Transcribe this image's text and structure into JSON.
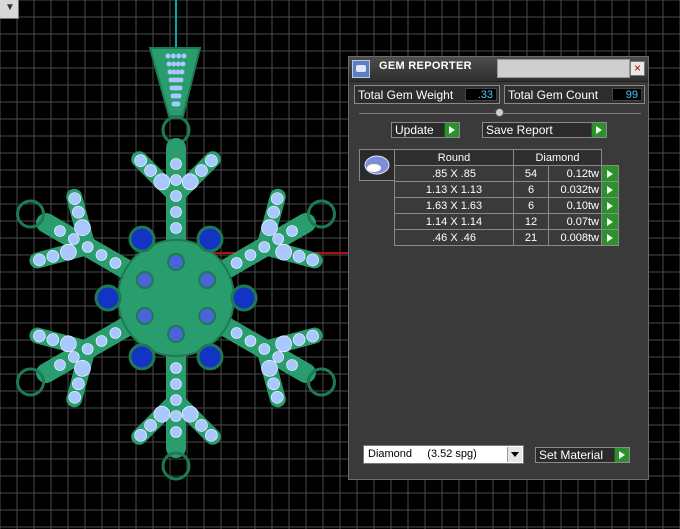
{
  "panel": {
    "title": "GEM REPORTER",
    "close_glyph": "×",
    "total_weight_label": "Total Gem Weight",
    "total_weight_value": ".33",
    "total_count_label": "Total Gem Count",
    "total_count_value": "99",
    "update_label": "Update",
    "save_label": "Save Report",
    "table": {
      "headers": [
        "Round",
        "Diamond"
      ],
      "rows": [
        {
          "size": ".85 X .85",
          "count": "54",
          "weight": "0.12tw"
        },
        {
          "size": "1.13 X 1.13",
          "count": "6",
          "weight": "0.032tw"
        },
        {
          "size": "1.63 X 1.63",
          "count": "6",
          "weight": "0.10tw"
        },
        {
          "size": "1.14 X 1.14",
          "count": "12",
          "weight": "0.07tw"
        },
        {
          "size": ".46 X .46",
          "count": "21",
          "weight": "0.008tw"
        }
      ]
    },
    "material_select": "Diamond     (3.52 spg)",
    "set_material_label": "Set Material"
  },
  "viewport": {
    "corner_glyph": "▼"
  },
  "colors": {
    "metal": "#2a9d6e",
    "metal_dark": "#1d7a52",
    "small_gem": "#a9c8ff",
    "large_gem": "#1233c4",
    "grid_line": "#4a4a4a",
    "axis_cyan": "#00a9b8",
    "axis_red": "#b01010",
    "accent_value": "#47c8ff"
  }
}
